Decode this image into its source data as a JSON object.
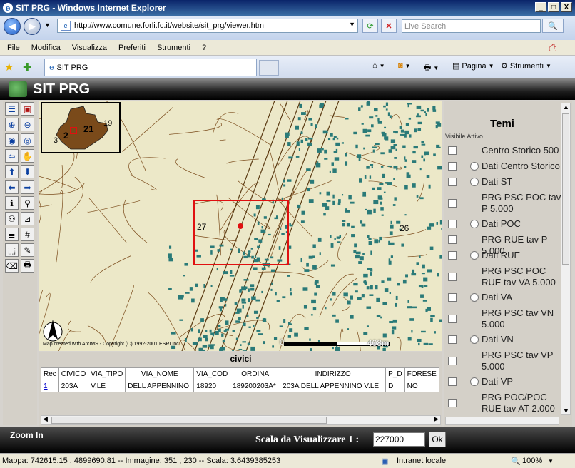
{
  "window": {
    "title": "SIT PRG - Windows Internet Explorer",
    "minimize": "_",
    "maximize": "□",
    "close": "X"
  },
  "browser": {
    "url": "http://www.comune.forli.fc.it/website/sit_prg/viewer.htm",
    "search_placeholder": "Live Search",
    "menu": [
      "File",
      "Modifica",
      "Visualizza",
      "Preferiti",
      "Strumenti",
      "?"
    ],
    "tab_title": "SIT PRG",
    "cmd_pagina": "Pagina",
    "cmd_strumenti": "Strumenti"
  },
  "app": {
    "title": "SIT PRG"
  },
  "map": {
    "scale_left": "0",
    "scale_right": "408m",
    "copyright": "Map created with ArcIMS - Copyright (C) 1992-2001 ESRI Inc.",
    "label_27": "27",
    "label_26": "26",
    "index_labels": [
      "21",
      "19",
      "2",
      "3"
    ]
  },
  "table": {
    "title": "civici",
    "columns": [
      "Rec",
      "CIVICO",
      "VIA_TIPO",
      "VIA_NOME",
      "VIA_COD",
      "ORDINA",
      "INDIRIZZO",
      "P_D",
      "FORESE"
    ],
    "rows": [
      [
        "1",
        "203A",
        "V.LE",
        "DELL APPENNINO",
        "18920",
        "189200203A*",
        "203A DELL APPENNINO V.LE",
        "D",
        "NO"
      ]
    ]
  },
  "temi": {
    "title": "Temi",
    "subtitle": "Visibile Attivo",
    "layers": [
      {
        "label": "Centro Storico 500",
        "radio": false
      },
      {
        "label": "Dati Centro Storico",
        "radio": true
      },
      {
        "label": "Dati ST",
        "radio": true
      },
      {
        "label": "PRG PSC POC tav P 5.000",
        "radio": false
      },
      {
        "label": "Dati POC",
        "radio": true
      },
      {
        "label": "PRG RUE tav P 5.000",
        "radio": false
      },
      {
        "label": "Dati RUE",
        "radio": true
      },
      {
        "label": "PRG PSC POC RUE tav VA 5.000",
        "radio": false
      },
      {
        "label": "Dati VA",
        "radio": true
      },
      {
        "label": "PRG PSC tav VN 5.000",
        "radio": false
      },
      {
        "label": "Dati VN",
        "radio": true
      },
      {
        "label": "PRG PSC tav VP 5.000",
        "radio": false
      },
      {
        "label": "Dati VP",
        "radio": true
      },
      {
        "label": "PRG POC/POC RUE tav AT 2.000",
        "radio": false
      }
    ]
  },
  "bottom": {
    "mode": "Zoom In",
    "scale_label": "Scala da Visualizzare 1 :",
    "scale_value": "227000",
    "ok": "Ok"
  },
  "status": {
    "coords": "Mappa: 742615.15 , 4899690.81 -- Immagine: 351 , 230 -- Scala: 3.6439385253",
    "zone": "Intranet locale",
    "zoom": "100%"
  },
  "colors": {
    "teal": "#2a7a78",
    "brown": "#7a4a1a",
    "red": "#e01010",
    "map_bg": "#ece8c8"
  }
}
